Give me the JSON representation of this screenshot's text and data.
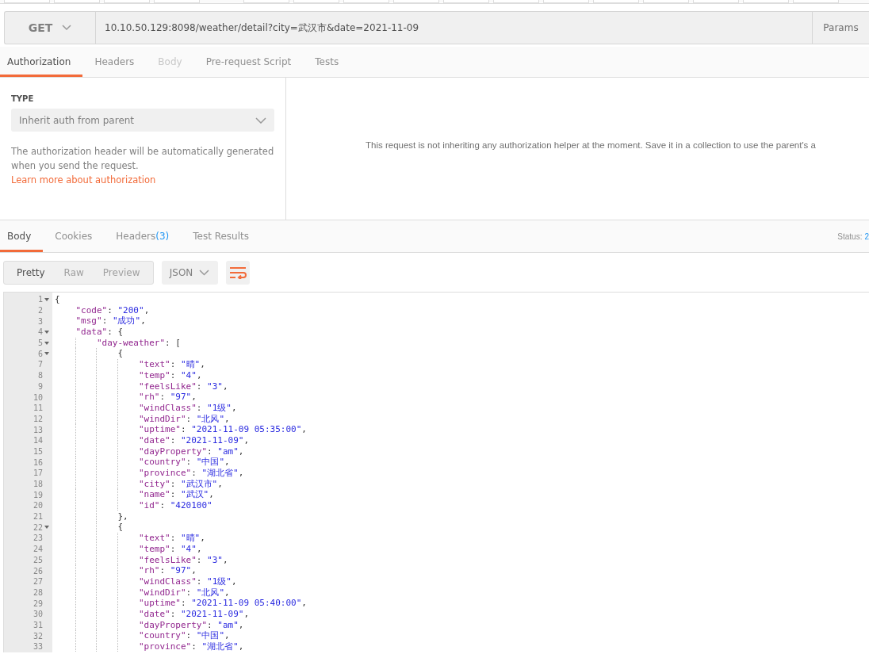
{
  "url_bar": {
    "method": "GET",
    "url": "10.10.50.129:8098/weather/detail?city=武汉市&date=2021-11-09",
    "params_button": "Params"
  },
  "request_tabs": [
    {
      "label": "Authorization",
      "selected": true,
      "disabled": false
    },
    {
      "label": "Headers",
      "selected": false,
      "disabled": false
    },
    {
      "label": "Body",
      "selected": false,
      "disabled": true
    },
    {
      "label": "Pre-request Script",
      "selected": false,
      "disabled": false
    },
    {
      "label": "Tests",
      "selected": false,
      "disabled": false
    }
  ],
  "auth": {
    "type_label": "TYPE",
    "type_value": "Inherit auth from parent",
    "help_text": "The authorization header will be automatically generated when you send the request.",
    "help_link": "Learn more about authorization",
    "message": "This request is not inheriting any authorization helper at the moment. Save it in a collection to use the parent's a"
  },
  "response_tabs": [
    {
      "label": "Body",
      "selected": true
    },
    {
      "label": "Cookies",
      "selected": false
    },
    {
      "label": "Headers",
      "count": "(3)",
      "selected": false
    },
    {
      "label": "Test Results",
      "selected": false
    }
  ],
  "status": {
    "label": "Status:",
    "value": "2"
  },
  "view_modes": [
    {
      "label": "Pretty",
      "selected": true
    },
    {
      "label": "Raw",
      "selected": false
    },
    {
      "label": "Preview",
      "selected": false
    }
  ],
  "format_select": "JSON",
  "code_lines": [
    {
      "number": "1",
      "foldable": true,
      "code": "{"
    },
    {
      "number": "2",
      "foldable": false,
      "code": "    \"code\": \"200\","
    },
    {
      "number": "3",
      "foldable": false,
      "code": "    \"msg\": \"成功\","
    },
    {
      "number": "4",
      "foldable": true,
      "code": "    \"data\": {"
    },
    {
      "number": "5",
      "foldable": true,
      "code": "        \"day-weather\": ["
    },
    {
      "number": "6",
      "foldable": true,
      "code": "            {"
    },
    {
      "number": "7",
      "foldable": false,
      "code": "                \"text\": \"晴\","
    },
    {
      "number": "8",
      "foldable": false,
      "code": "                \"temp\": \"4\","
    },
    {
      "number": "9",
      "foldable": false,
      "code": "                \"feelsLike\": \"3\","
    },
    {
      "number": "10",
      "foldable": false,
      "code": "                \"rh\": \"97\","
    },
    {
      "number": "11",
      "foldable": false,
      "code": "                \"windClass\": \"1级\","
    },
    {
      "number": "12",
      "foldable": false,
      "code": "                \"windDir\": \"北风\","
    },
    {
      "number": "13",
      "foldable": false,
      "code": "                \"uptime\": \"2021-11-09 05:35:00\","
    },
    {
      "number": "14",
      "foldable": false,
      "code": "                \"date\": \"2021-11-09\","
    },
    {
      "number": "15",
      "foldable": false,
      "code": "                \"dayProperty\": \"am\","
    },
    {
      "number": "16",
      "foldable": false,
      "code": "                \"country\": \"中国\","
    },
    {
      "number": "17",
      "foldable": false,
      "code": "                \"province\": \"湖北省\","
    },
    {
      "number": "18",
      "foldable": false,
      "code": "                \"city\": \"武汉市\","
    },
    {
      "number": "19",
      "foldable": false,
      "code": "                \"name\": \"武汉\","
    },
    {
      "number": "20",
      "foldable": false,
      "code": "                \"id\": \"420100\""
    },
    {
      "number": "21",
      "foldable": false,
      "code": "            },"
    },
    {
      "number": "22",
      "foldable": true,
      "code": "            {"
    },
    {
      "number": "23",
      "foldable": false,
      "code": "                \"text\": \"晴\","
    },
    {
      "number": "24",
      "foldable": false,
      "code": "                \"temp\": \"4\","
    },
    {
      "number": "25",
      "foldable": false,
      "code": "                \"feelsLike\": \"3\","
    },
    {
      "number": "26",
      "foldable": false,
      "code": "                \"rh\": \"97\","
    },
    {
      "number": "27",
      "foldable": false,
      "code": "                \"windClass\": \"1级\","
    },
    {
      "number": "28",
      "foldable": false,
      "code": "                \"windDir\": \"北风\","
    },
    {
      "number": "29",
      "foldable": false,
      "code": "                \"uptime\": \"2021-11-09 05:40:00\","
    },
    {
      "number": "30",
      "foldable": false,
      "code": "                \"date\": \"2021-11-09\","
    },
    {
      "number": "31",
      "foldable": false,
      "code": "                \"dayProperty\": \"am\","
    },
    {
      "number": "32",
      "foldable": false,
      "code": "                \"country\": \"中国\","
    },
    {
      "number": "33",
      "foldable": false,
      "code": "                \"province\": \"湖北省\","
    }
  ]
}
